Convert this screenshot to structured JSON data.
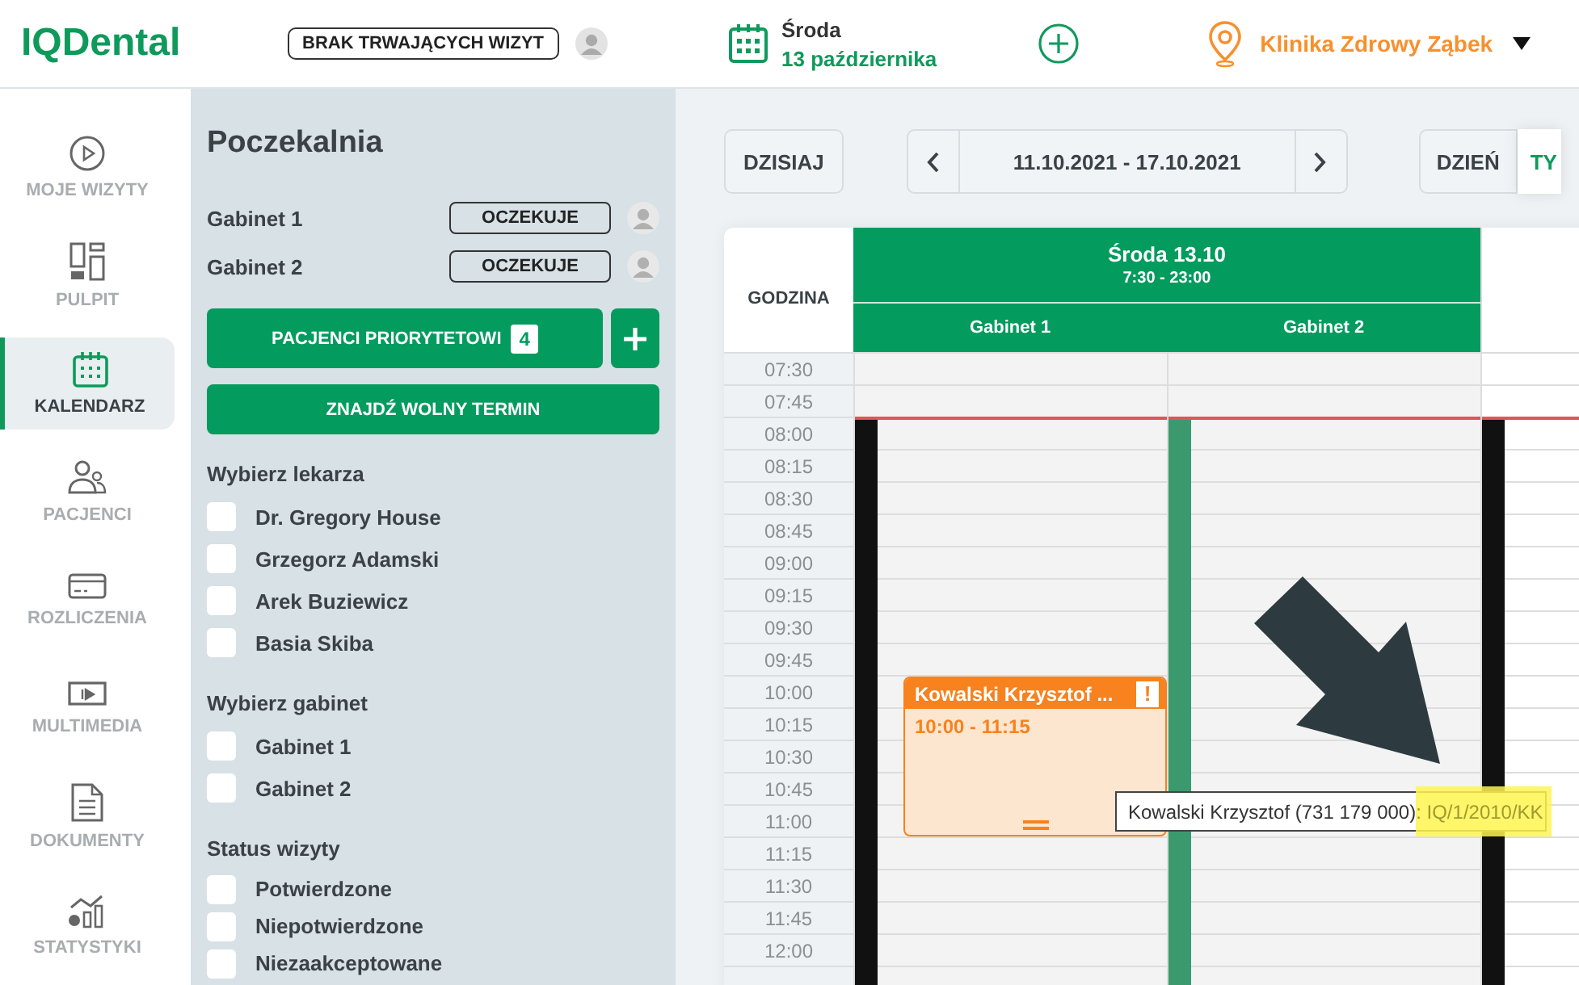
{
  "header": {
    "logo": "IQDental",
    "status_button": "BRAK TRWAJĄCYCH WIZYT",
    "weekday": "Środa",
    "date": "13 października",
    "clinic": "Klinika Zdrowy Ząbek"
  },
  "nav": [
    {
      "label": "MOJE WIZYTY",
      "kind": "play",
      "selected": false
    },
    {
      "label": "PULPIT",
      "kind": "dashboard",
      "selected": false
    },
    {
      "label": "KALENDARZ",
      "kind": "calendar",
      "selected": true
    },
    {
      "label": "PACJENCI",
      "kind": "people",
      "selected": false
    },
    {
      "label": "ROZLICZENIA",
      "kind": "card",
      "selected": false
    },
    {
      "label": "MULTIMEDIA",
      "kind": "media",
      "selected": false
    },
    {
      "label": "DOKUMENTY",
      "kind": "document",
      "selected": false
    },
    {
      "label": "STATYSTYKI",
      "kind": "stats",
      "selected": false
    }
  ],
  "waiting_room": {
    "title": "Poczekalnia",
    "rooms": [
      {
        "name": "Gabinet 1",
        "status": "OCZEKUJE"
      },
      {
        "name": "Gabinet 2",
        "status": "OCZEKUJE"
      }
    ],
    "priority_button": "PACJENCI PRIORYTETOWI",
    "priority_count": "4",
    "find_button": "ZNAJDŹ WOLNY TERMIN"
  },
  "filters": [
    {
      "title": "Wybierz lekarza",
      "options": [
        {
          "label": "Dr. Gregory House",
          "checked": false
        },
        {
          "label": "Grzegorz Adamski",
          "checked": false
        },
        {
          "label": "Arek Buziewicz",
          "checked": false
        },
        {
          "label": "Basia Skiba",
          "checked": false
        }
      ]
    },
    {
      "title": "Wybierz gabinet",
      "options": [
        {
          "label": "Gabinet 1",
          "checked": false
        },
        {
          "label": "Gabinet 2",
          "checked": false
        }
      ]
    },
    {
      "title": "Status wizyty",
      "options": [
        {
          "label": "Potwierdzone",
          "checked": false
        },
        {
          "label": "Niepotwierdzone",
          "checked": false
        },
        {
          "label": "Niezaakceptowane",
          "checked": false
        }
      ]
    }
  ],
  "toolbar": {
    "today": "DZISIAJ",
    "range": "11.10.2021 - 17.10.2021",
    "views": [
      {
        "label": "DZIEŃ",
        "selected": false
      },
      {
        "label": "TY",
        "selected": true
      }
    ]
  },
  "calendar": {
    "hour_header": "GODZINA",
    "day_title": "Środa 13.10",
    "day_hours": "7:30 - 23:00",
    "lanes": [
      {
        "label": "Gabinet 1",
        "color": "#111111",
        "events": [
          {
            "title": "Kowalski Krzysztof ...",
            "badge": "!",
            "time": "10:00 - 11:15"
          }
        ]
      },
      {
        "label": "Gabinet 2",
        "color": "#3a9a6e"
      },
      {
        "color": "#111111"
      }
    ],
    "times": [
      "07:30",
      "07:45",
      "08:00",
      "08:15",
      "08:30",
      "08:45",
      "09:00",
      "09:15",
      "09:30",
      "09:45",
      "10:00",
      "10:15",
      "10:30",
      "10:45",
      "11:00",
      "11:15",
      "11:30",
      "11:45",
      "12:00"
    ]
  },
  "tooltip": {
    "text": "Kowalski Krzysztof (731 179 000)",
    "highlight": ": IQ/1/2010/KK"
  }
}
